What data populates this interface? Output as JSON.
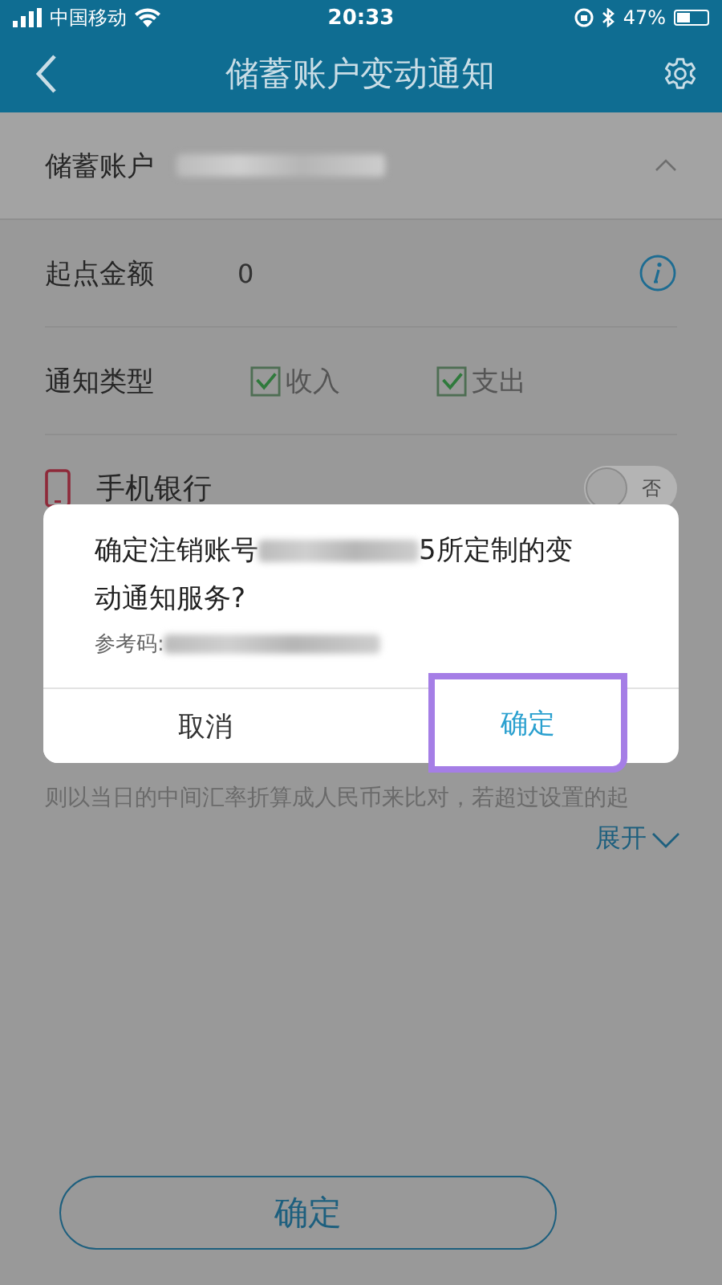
{
  "status_bar": {
    "carrier": "中国移动",
    "time": "20:33",
    "battery": "47%"
  },
  "nav": {
    "title": "储蓄账户变动通知"
  },
  "account": {
    "label": "储蓄账户",
    "expanded": true
  },
  "rows": [
    {
      "kind": "value",
      "label": "起点金额",
      "value": "0"
    },
    {
      "kind": "checks",
      "label": "通知类型",
      "options": [
        {
          "label": "收入",
          "checked": true
        },
        {
          "label": "支出",
          "checked": true
        }
      ]
    },
    {
      "kind": "switch",
      "label": "手机银行",
      "on": false,
      "switch_text": "否"
    }
  ],
  "note": "则以当日的中间汇率折算成人民币来比对，若超过设置的起",
  "expand_link": "展开",
  "confirm_button": "确定",
  "dialog": {
    "message_before": "确定注销账号",
    "message_after": "5所定制的变",
    "message_line2": "动通知服务?",
    "reference_label": "参考码:",
    "buttons": [
      {
        "label": "取消",
        "primary": false,
        "highlighted": false
      },
      {
        "label": "确定",
        "primary": true,
        "highlighted": true
      }
    ]
  }
}
